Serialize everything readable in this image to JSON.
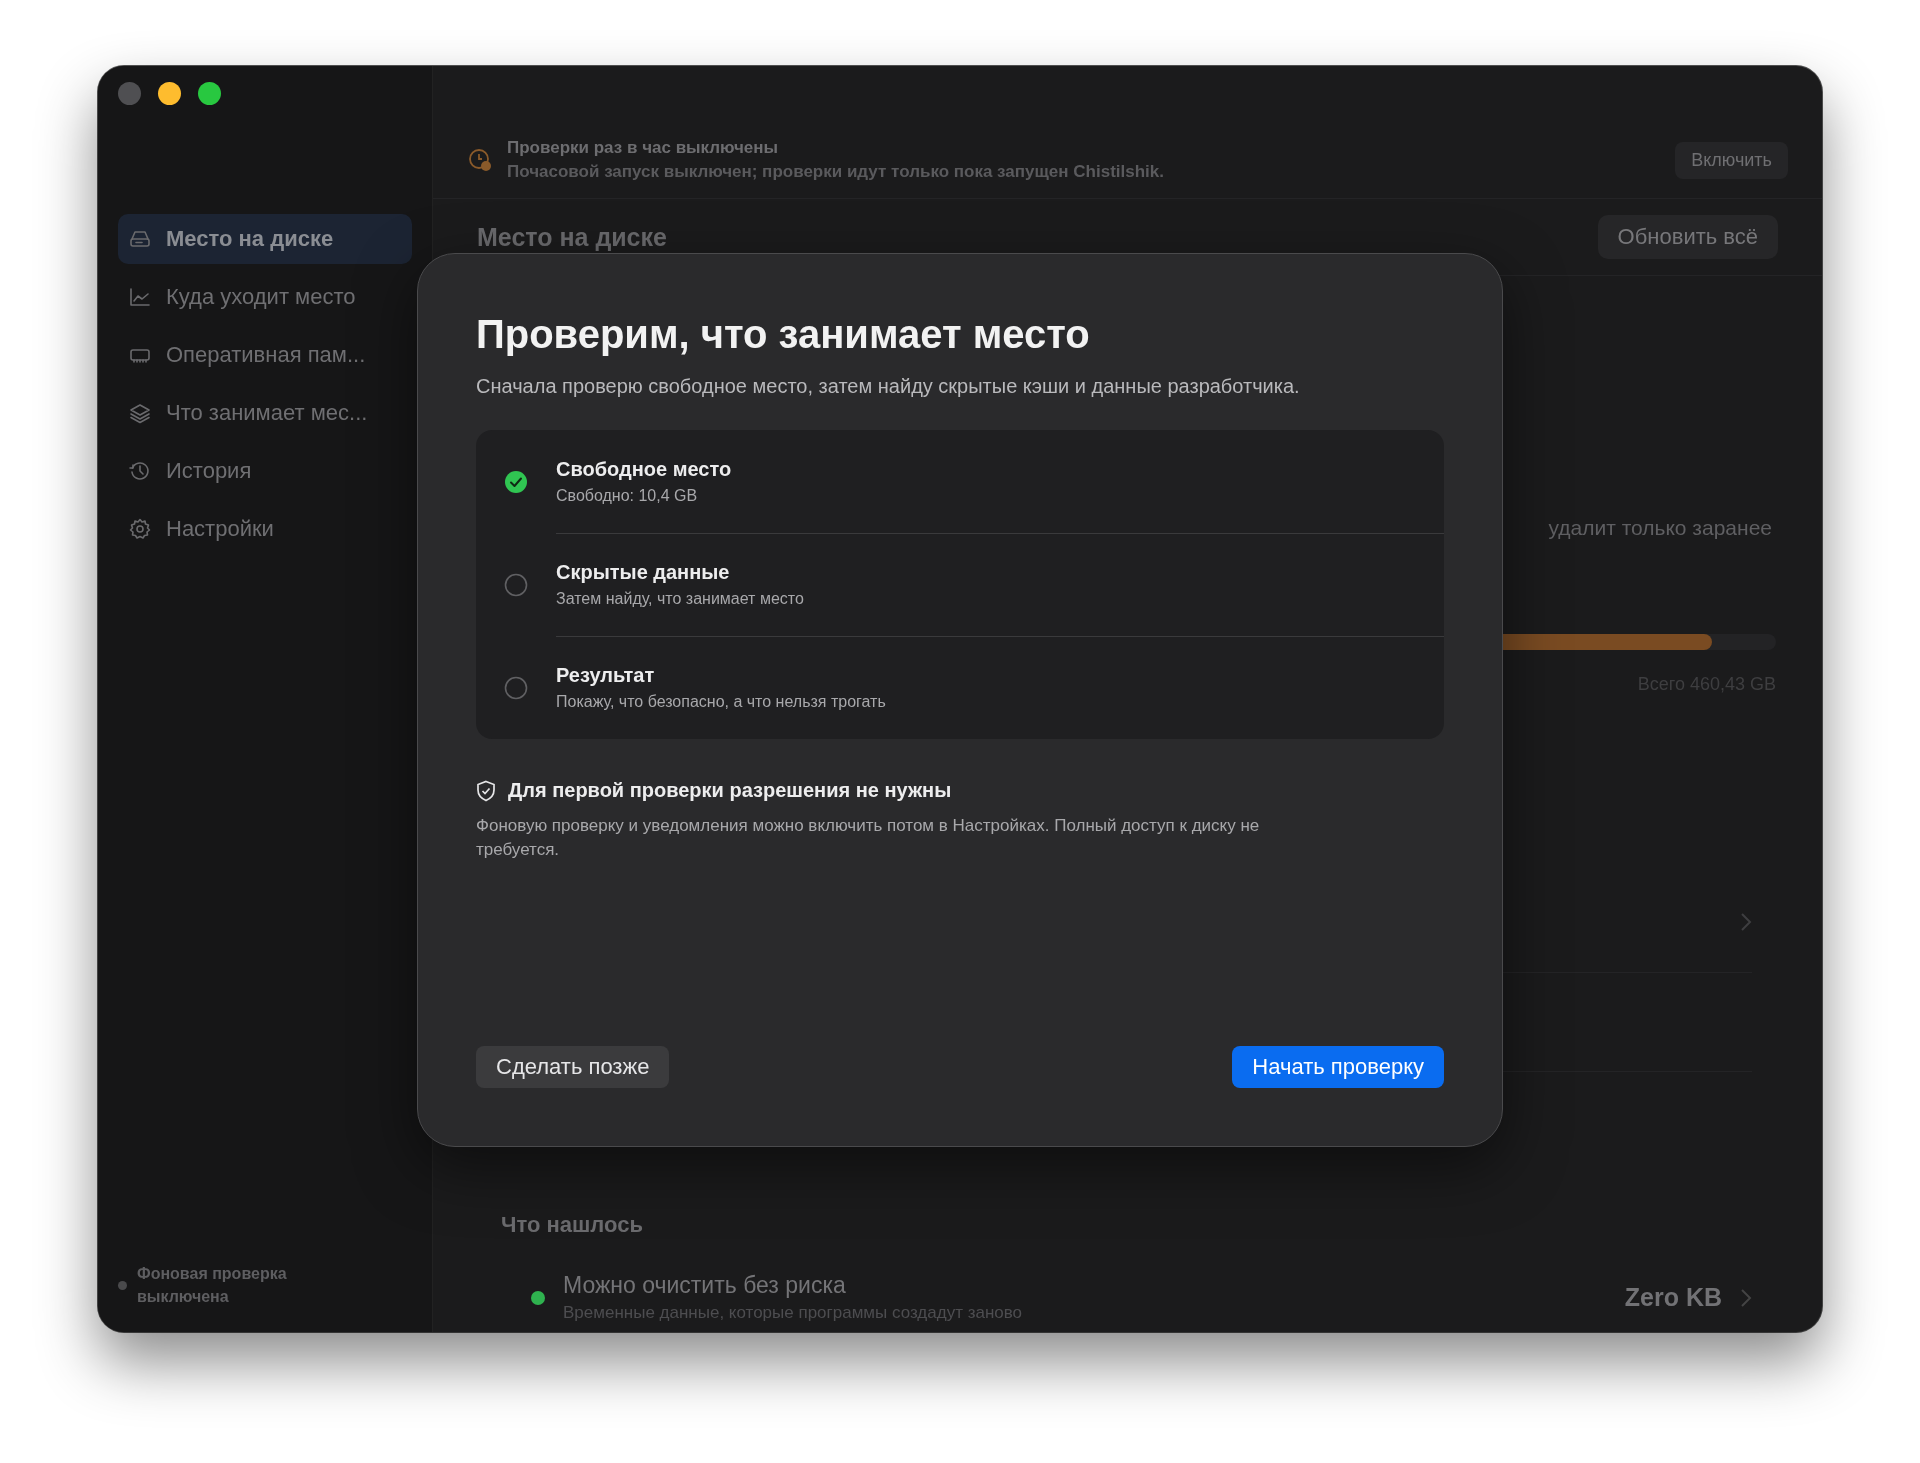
{
  "window": {
    "controls": [
      {
        "color": "#4f4f52"
      },
      {
        "color": "#febc2e"
      },
      {
        "color": "#28c840"
      }
    ]
  },
  "sidebar": {
    "items": [
      {
        "label": "Место на диске",
        "selected": true
      },
      {
        "label": "Куда уходит место",
        "selected": false
      },
      {
        "label": "Оперативная пам...",
        "selected": false
      },
      {
        "label": "Что занимает мес...",
        "selected": false
      },
      {
        "label": "История",
        "selected": false
      },
      {
        "label": "Настройки",
        "selected": false
      }
    ],
    "status": {
      "text": "Фоновая проверка выключена",
      "on": false
    }
  },
  "banner": {
    "title": "Проверки раз в час выключены",
    "text": "Почасовой запуск выключен; проверки идут только пока запущен Chistilshik.",
    "button": "Включить"
  },
  "header": {
    "title": "Место на диске",
    "button": "Обновить всё"
  },
  "summary": {
    "note": "удалит только заранее",
    "usage": {
      "level": 0.95
    },
    "total": "Всего 460,43 GB"
  },
  "findings": {
    "title": "Что нашлось",
    "items": [
      {
        "title": "Можно очистить без риска",
        "subtitle": "Временные данные, которые программы создадут заново",
        "size": "Zero KB",
        "color": "#2fb24f"
      }
    ]
  },
  "dialog": {
    "title": "Проверим, что занимает место",
    "subtitle": "Сначала проверю свободное место, затем найду скрытые кэши и данные разработчика.",
    "steps": [
      {
        "title": "Свободное место",
        "subtitle": "Свободно: 10,4 GB",
        "done": true
      },
      {
        "title": "Скрытые данные",
        "subtitle": "Затем найду, что занимает место",
        "done": false
      },
      {
        "title": "Результат",
        "subtitle": "Покажу, что безопасно, а что нельзя трогать",
        "done": false
      }
    ],
    "permission": {
      "title": "Для первой проверки разрешения не нужны",
      "text": "Фоновую проверку и уведомления можно включить потом в Настройках. Полный доступ к диску не требуется."
    },
    "buttons": [
      {
        "label": "Сделать позже",
        "kind": "secondary"
      },
      {
        "label": "Начать проверку",
        "kind": "primary"
      }
    ]
  }
}
